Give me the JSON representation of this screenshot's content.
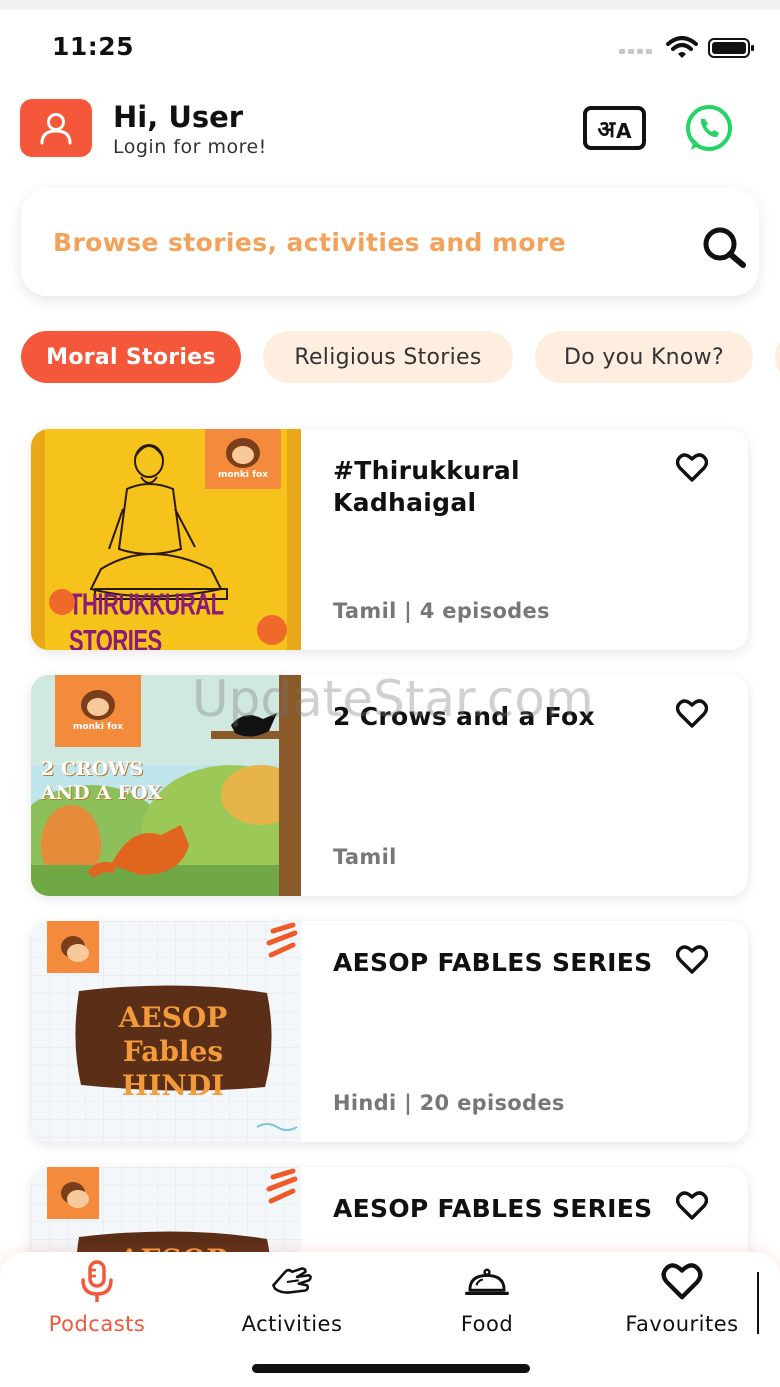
{
  "status_bar": {
    "time": "11:25"
  },
  "header": {
    "greeting": "Hi, User",
    "subtitle": "Login for more!",
    "language_icon": "language-toggle-icon",
    "whatsapp_icon": "whatsapp-icon"
  },
  "search": {
    "placeholder": "Browse stories, activities and more"
  },
  "categories": [
    {
      "label": "Moral Stories",
      "active": true
    },
    {
      "label": "Religious Stories",
      "active": false
    },
    {
      "label": "Do you Know?",
      "active": false
    }
  ],
  "stories": [
    {
      "title": "#Thirukkural Kadhaigal",
      "meta": "Tamil | 4 episodes",
      "cover_text": "THIRUKKURAL STORIES",
      "favourite": false
    },
    {
      "title": "2 Crows and a Fox",
      "meta": "Tamil",
      "cover_text": "2 CROWS AND A FOX",
      "favourite": false
    },
    {
      "title": "AESOP FABLES SERIES",
      "meta": "Hindi | 20 episodes",
      "cover_text": "AESOP Fables HINDI",
      "favourite": false
    },
    {
      "title": "AESOP FABLES SERIES",
      "meta": "",
      "cover_text": "AESOP",
      "favourite": false
    }
  ],
  "brand": {
    "badge_text": "monki fox"
  },
  "watermark": "UpdateStar.com",
  "bottom_nav": [
    {
      "label": "Podcasts",
      "icon": "microphone-icon",
      "active": true
    },
    {
      "label": "Activities",
      "icon": "hand-wave-icon",
      "active": false
    },
    {
      "label": "Food",
      "icon": "food-cloche-icon",
      "active": false
    },
    {
      "label": "Favourites",
      "icon": "heart-icon",
      "active": false
    }
  ],
  "colors": {
    "accent": "#f4573a",
    "placeholder": "#f3a25b",
    "chip_inactive": "#fdeee0"
  }
}
